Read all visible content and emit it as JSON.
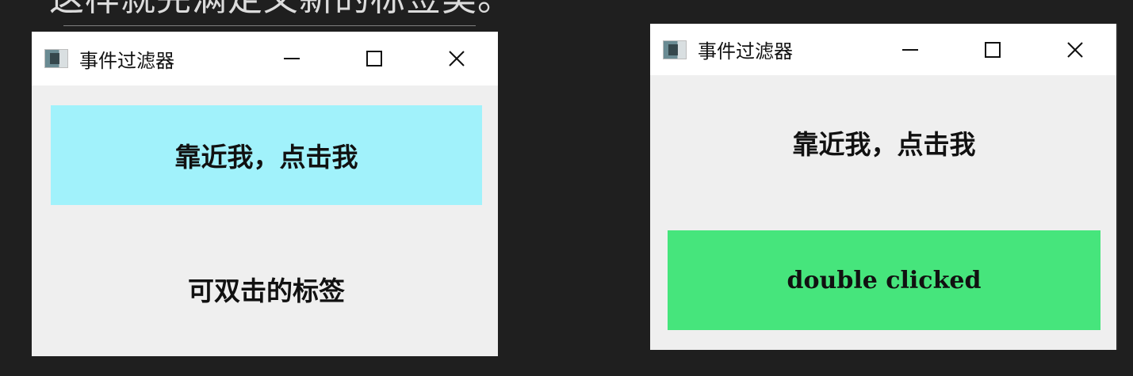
{
  "background_text": "这样就完满定义新的标签类。",
  "colors": {
    "desktop_bg": "#1f1f1f",
    "window_bg": "#efefef",
    "titlebar_bg": "#ffffff",
    "hover_label_bg": "#a1f2fb",
    "double_clicked_bg": "#46e57c"
  },
  "windows": [
    {
      "title": "事件过滤器",
      "controls": [
        "minimize-icon",
        "maximize-icon",
        "close-icon"
      ],
      "labels": {
        "hover_label": "靠近我，点击我",
        "double_click_label": "可双击的标签"
      }
    },
    {
      "title": "事件过滤器",
      "controls": [
        "minimize-icon",
        "maximize-icon",
        "close-icon"
      ],
      "labels": {
        "hover_label": "靠近我，点击我",
        "double_click_label": "double clicked"
      }
    }
  ]
}
